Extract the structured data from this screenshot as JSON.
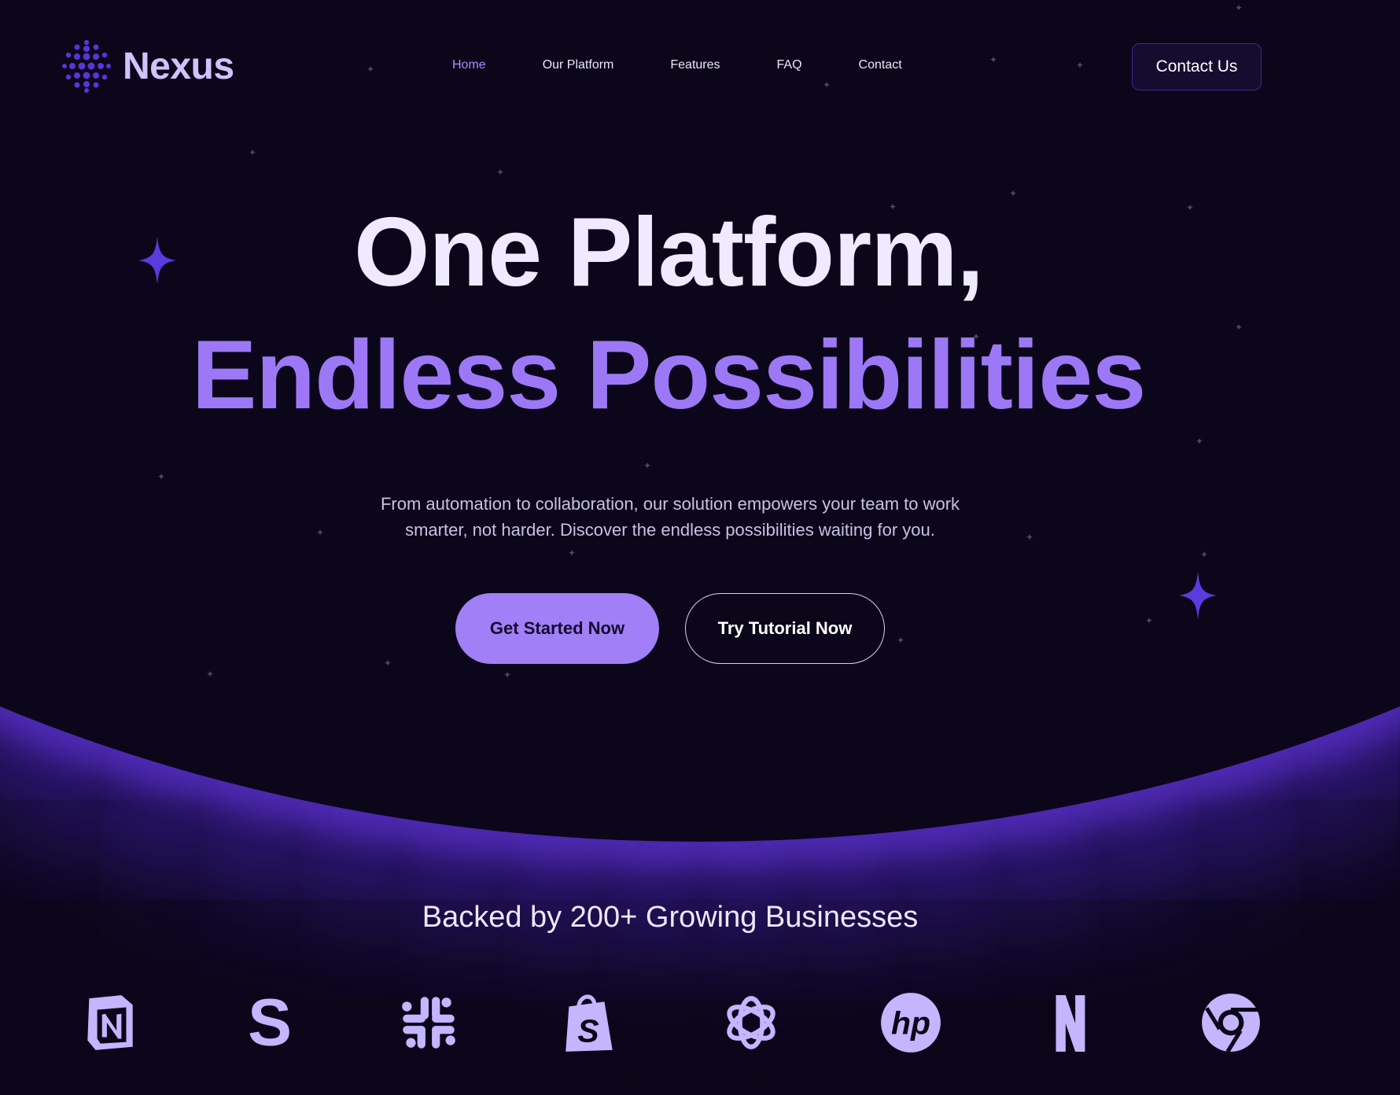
{
  "brand": {
    "name": "Nexus",
    "logo_icon": "dotted-sphere-icon"
  },
  "nav": {
    "links": [
      {
        "label": "Home",
        "active": true
      },
      {
        "label": "Our Platform",
        "active": false
      },
      {
        "label": "Features",
        "active": false
      },
      {
        "label": "FAQ",
        "active": false
      },
      {
        "label": "Contact",
        "active": false
      }
    ],
    "cta_label": "Contact Us"
  },
  "hero": {
    "title_line1": "One Platform,",
    "title_line2": "Endless Possibilities",
    "subtitle_line1": "From automation to collaboration, our solution empowers your team to work",
    "subtitle_line2": "smarter, not harder. Discover the endless possibilities waiting for you.",
    "primary_cta": "Get Started Now",
    "secondary_cta": "Try Tutorial Now"
  },
  "partners": {
    "heading": "Backed by 200+ Growing Businesses",
    "logos": [
      "notion-icon",
      "stripe-icon",
      "slack-icon",
      "shopify-icon",
      "openai-icon",
      "hp-icon",
      "netflix-icon",
      "chrome-icon"
    ]
  },
  "colors": {
    "background": "#0b0619",
    "accent": "#9d78f6",
    "button_primary": "#a07ff7",
    "nav_active": "#a98dff",
    "logo_tint": "#c4b5ff"
  }
}
